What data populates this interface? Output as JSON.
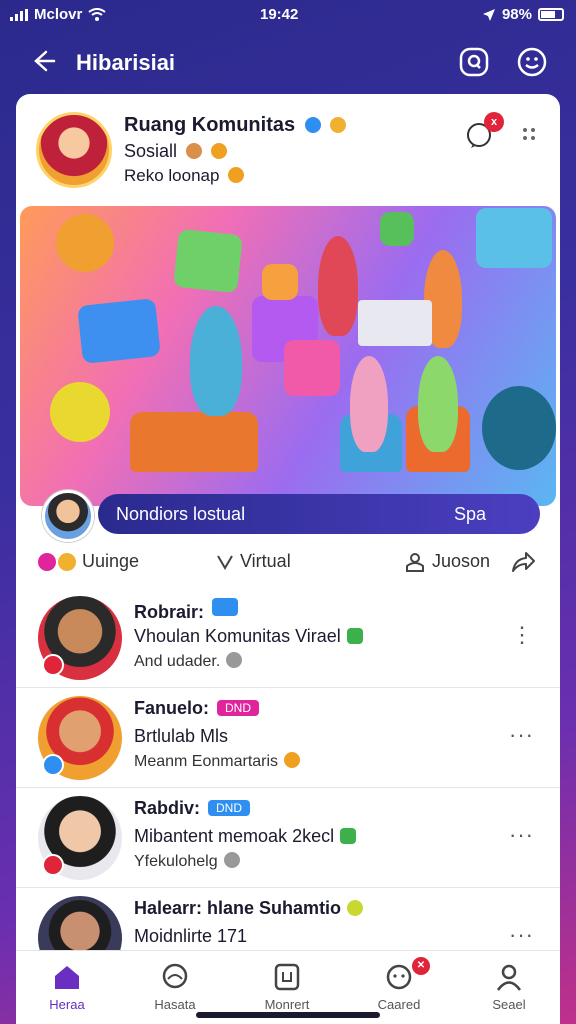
{
  "status": {
    "carrier": "Mclovr",
    "time": "19:42",
    "battery": "98%"
  },
  "topbar": {
    "title": "Hibarisiai"
  },
  "community": {
    "name": "Ruang Komunitas",
    "line1": "Sosiall",
    "line2": "Reko loonap",
    "chat_badge": "x"
  },
  "hero": {
    "label_left": "Nondiors lostual",
    "label_right": "Spa"
  },
  "actions": {
    "left": "Uuinge",
    "middle": "Virtual",
    "right": "Juoson"
  },
  "posts": [
    {
      "name": "Robrair:",
      "tag": "",
      "line1": "Vhoulan Komunitas Virael",
      "line2": "And udader."
    },
    {
      "name": "Fanuelo:",
      "tag": "DND",
      "line1": "Brtlulab Mls",
      "line2": "Meanm Eonmartaris"
    },
    {
      "name": "Rabdiv:",
      "tag": "DND",
      "line1": "Mibantent memoak 2kecl",
      "line2": "Yfekulohelg"
    },
    {
      "name": "Halearr: hlane Suhamtio",
      "tag": "",
      "line1": "Moidnlirte 171",
      "line2": ""
    }
  ],
  "tabs": [
    {
      "label": "Heraa",
      "icon": "home-icon"
    },
    {
      "label": "Hasata",
      "icon": "chat-bubble-icon"
    },
    {
      "label": "Monrert",
      "icon": "square-icon"
    },
    {
      "label": "Caared",
      "icon": "notification-icon"
    },
    {
      "label": "Seael",
      "icon": "profile-icon"
    }
  ],
  "colors": {
    "accent": "#6a2fc0",
    "badge": "#e0253a",
    "tag_blue": "#2f8ff0",
    "tag_pink": "#e0259c"
  }
}
